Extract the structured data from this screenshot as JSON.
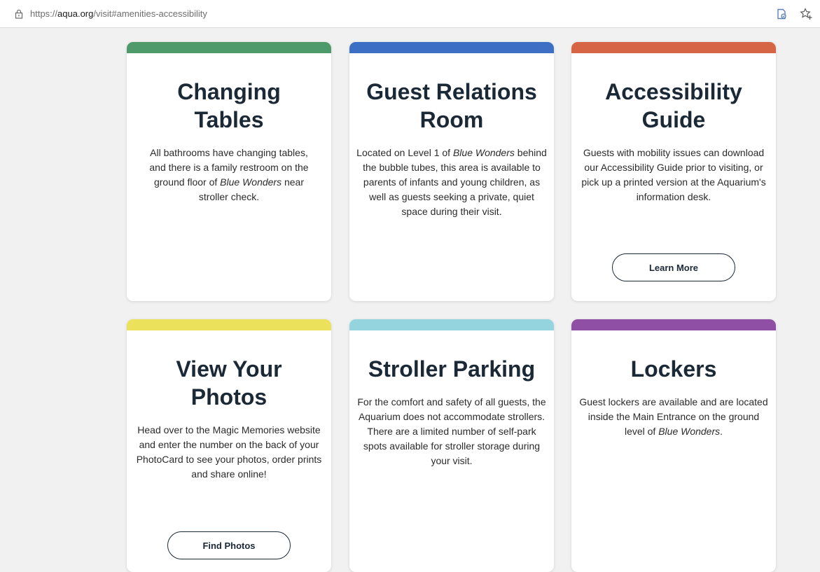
{
  "browser": {
    "url_prefix": "https://",
    "url_host": "aqua.org",
    "url_path": "/visit#amenities-accessibility"
  },
  "cards": [
    {
      "title_line1": "Changing",
      "title_line2": "Tables",
      "accent": "#4e9a6a",
      "text": [
        "All bathrooms have changing tables, and there is a family restroom on the ground floor of ",
        "Blue Wonders",
        " near stroller check."
      ]
    },
    {
      "title_line1": "Guest Relations",
      "title_line2": "Room",
      "accent": "#3d70c4",
      "text": [
        "Located on Level 1 of ",
        "Blue Wonders",
        " behind the bubble tubes, this area is available to parents of infants and young children, as well as guests seeking a private, quiet space during their visit."
      ]
    },
    {
      "title_line1": "Accessibility",
      "title_line2": "Guide",
      "accent": "#d66545",
      "text": [
        "Guests with mobility issues can download our Accessibility Guide prior to visiting, or pick up a printed version at the Aquarium's information desk."
      ],
      "button": "Learn More"
    },
    {
      "title_line1": "View Your",
      "title_line2": "Photos",
      "accent": "#ebe15a",
      "text": [
        "Head over to the Magic Memories website and enter the number on the back of your PhotoCard to see your photos, order prints and share online!"
      ],
      "button": "Find Photos"
    },
    {
      "title_line1": "Stroller Parking",
      "title_line2": "",
      "accent": "#93d4df",
      "text": [
        "For the comfort and safety of all guests, the Aquarium does not accommodate strollers. There are a limited number of self-park spots available for stroller storage during your visit."
      ]
    },
    {
      "title_line1": "Lockers",
      "title_line2": "",
      "accent": "#8e4fa4",
      "text": [
        "Guest lockers are available and are located inside the Main Entrance on the ground level of ",
        "Blue Wonders",
        "."
      ]
    }
  ]
}
